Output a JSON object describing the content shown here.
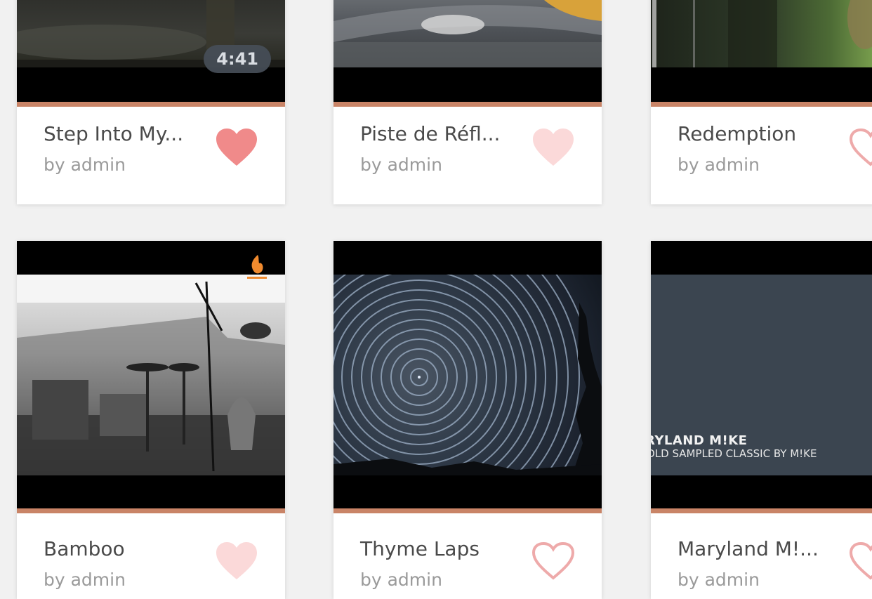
{
  "colors": {
    "accent": "#c98467",
    "heart_filled": "#f08a8a",
    "heart_faded": "#fbd9d9",
    "heart_outline": "#eeaaaa"
  },
  "cards": [
    {
      "title": "Step Into My...",
      "author": "by admin",
      "duration": "4:41",
      "heart_state": "filled"
    },
    {
      "title": "Piste de Réfl...",
      "author": "by admin",
      "heart_state": "faded"
    },
    {
      "title": "Redemption",
      "author": "by admin",
      "heart_state": "outline"
    },
    {
      "title": "Bamboo",
      "author": "by admin",
      "heart_state": "faded",
      "badge_icon": "flame-icon"
    },
    {
      "title": "Thyme Laps",
      "author": "by admin",
      "heart_state": "outline"
    },
    {
      "title": "Maryland M!...",
      "author": "by admin",
      "heart_state": "outline",
      "overlay_line1": "RYLAND M!KE",
      "overlay_line2": "OLD SAMPLED CLASSIC BY M!KE"
    }
  ]
}
